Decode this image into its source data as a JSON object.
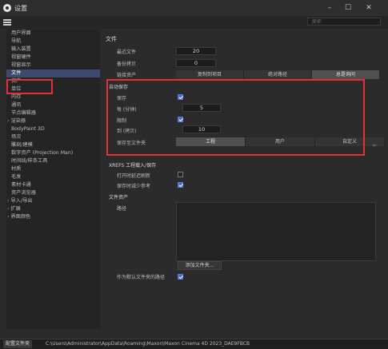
{
  "window": {
    "title": "设置",
    "controls": [
      "–",
      "☐",
      "✕"
    ]
  },
  "search": {
    "placeholder": "搜索"
  },
  "sidebar": {
    "items": [
      {
        "label": "用户界面",
        "selected": false,
        "expandable": false
      },
      {
        "label": "导航",
        "selected": false,
        "expandable": false
      },
      {
        "label": "输入装置",
        "selected": false,
        "expandable": false
      },
      {
        "label": "视窗硬件",
        "selected": false,
        "expandable": false
      },
      {
        "label": "视窗显示",
        "selected": false,
        "expandable": false
      },
      {
        "label": "文件",
        "selected": true,
        "expandable": false
      },
      {
        "label": "资产",
        "selected": false,
        "expandable": false
      },
      {
        "label": "单位",
        "selected": false,
        "expandable": false
      },
      {
        "label": "内存",
        "selected": false,
        "expandable": false
      },
      {
        "label": "通讯",
        "selected": false,
        "expandable": false
      },
      {
        "label": "节点编辑器",
        "selected": false,
        "expandable": false
      },
      {
        "label": "渲染器",
        "selected": false,
        "expandable": true
      },
      {
        "label": "BodyPaint 3D",
        "selected": false,
        "expandable": false
      },
      {
        "label": "场次",
        "selected": false,
        "expandable": false
      },
      {
        "label": "雕刻/建模",
        "selected": false,
        "expandable": false
      },
      {
        "label": "数字资产 (Projection Man)",
        "selected": false,
        "expandable": false
      },
      {
        "label": "时间线/样条工具",
        "selected": false,
        "expandable": false
      },
      {
        "label": "材质",
        "selected": false,
        "expandable": false
      },
      {
        "label": "毛发",
        "selected": false,
        "expandable": false
      },
      {
        "label": "素材卡通",
        "selected": false,
        "expandable": false
      },
      {
        "label": "资产浏览器",
        "selected": false,
        "expandable": false
      },
      {
        "label": "导入/导出",
        "selected": false,
        "expandable": true
      },
      {
        "label": "扩展",
        "selected": false,
        "expandable": true
      },
      {
        "label": "界面颜色",
        "selected": false,
        "expandable": true
      }
    ]
  },
  "file_section": {
    "title": "文件",
    "recent_files_label": "最近文件",
    "recent_files_value": "20",
    "backup_copies_label": "备份拷贝",
    "backup_copies_value": "0",
    "link_assets_label": "链接资产",
    "link_assets_options": [
      "复制到项目",
      "绝对路径",
      "总是询问"
    ],
    "link_assets_selected": 2
  },
  "autosave": {
    "title": "自动保存",
    "save_label": "保存",
    "save_checked": true,
    "every_label": "每 (分钟)",
    "every_value": "5",
    "limit_label": "限制",
    "limit_checked": true,
    "to_label": "到 (拷贝)",
    "to_value": "10",
    "save_to_label": "保存至文件夹",
    "save_to_options": [
      "工程",
      "用户",
      "自定义"
    ],
    "save_to_selected": 0
  },
  "xrefs": {
    "title": "XREFS 工程载入/保存",
    "open_label": "打开时延迟刷新",
    "open_checked": false,
    "keep_label": "保存时减少参考",
    "keep_checked": true
  },
  "file_assets": {
    "title": "文件资产",
    "paths_label": "路径",
    "add_folder_button": "添加文件夹...",
    "as_default_label": "作为默认文件夹的路径",
    "as_default_checked": true
  },
  "statusbar": {
    "button": "配置文件夹",
    "path": "C:\\Users\\Administrator\\AppData\\Roaming\\Maxon\\Maxon Cinema 4D 2023_DAE9FBCB"
  },
  "colors": {
    "accent": "#4a6bd0",
    "highlight_box": "#e0303a",
    "selection": "#3c4a6e"
  }
}
